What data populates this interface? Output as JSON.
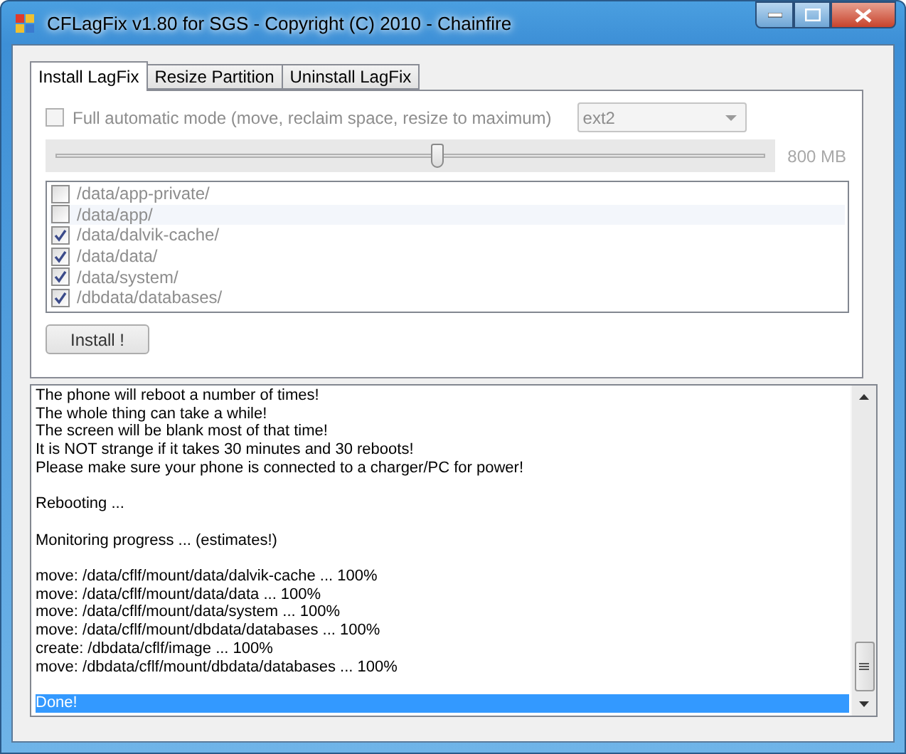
{
  "window": {
    "title": "CFLagFix v1.80 for SGS - Copyright (C) 2010 - Chainfire"
  },
  "tabs": [
    {
      "label": "Install LagFix",
      "selected": true
    },
    {
      "label": "Resize Partition",
      "selected": false
    },
    {
      "label": "Uninstall LagFix",
      "selected": false
    }
  ],
  "auto_mode": {
    "label": "Full automatic mode (move, reclaim space, resize to maximum)",
    "checked": false,
    "disabled": true
  },
  "filesystem_combo": {
    "value": "ext2",
    "disabled": true
  },
  "size_slider": {
    "level": 0.54,
    "reading": "800 MB",
    "disabled": true
  },
  "folders": {
    "disabled": true,
    "items": [
      {
        "label": "/data/app-private/",
        "checked": false,
        "selected": false
      },
      {
        "label": "/data/app/",
        "checked": false,
        "selected": true
      },
      {
        "label": "/data/dalvik-cache/",
        "checked": true,
        "selected": false
      },
      {
        "label": "/data/data/",
        "checked": true,
        "selected": false
      },
      {
        "label": "/data/system/",
        "checked": true,
        "selected": false
      },
      {
        "label": "/dbdata/databases/",
        "checked": true,
        "selected": false
      }
    ]
  },
  "install_button": {
    "label": "Install !"
  },
  "log": [
    {
      "text": "The phone will reboot a number of times!",
      "gap_before": false,
      "selected": false
    },
    {
      "text": "The whole thing can take a while!",
      "gap_before": false,
      "selected": false
    },
    {
      "text": "The screen will be blank most of that time!",
      "gap_before": false,
      "selected": false
    },
    {
      "text": "It is NOT strange if it takes 30 minutes and 30 reboots!",
      "gap_before": false,
      "selected": false
    },
    {
      "text": "Please make sure your phone is connected to a charger/PC for power!",
      "gap_before": false,
      "selected": false
    },
    {
      "text": "Rebooting ...",
      "gap_before": true,
      "selected": false
    },
    {
      "text": "Monitoring progress ... (estimates!)",
      "gap_before": true,
      "selected": false
    },
    {
      "text": "move: /data/cflf/mount/data/dalvik-cache ... 100%",
      "gap_before": true,
      "selected": false
    },
    {
      "text": "move: /data/cflf/mount/data/data ... 100%",
      "gap_before": false,
      "selected": false
    },
    {
      "text": "move: /data/cflf/mount/data/system ... 100%",
      "gap_before": false,
      "selected": false
    },
    {
      "text": "move: /data/cflf/mount/dbdata/databases ... 100%",
      "gap_before": false,
      "selected": false
    },
    {
      "text": "create: /dbdata/cflf/image ... 100%",
      "gap_before": false,
      "selected": false
    },
    {
      "text": "move: /dbdata/cflf/mount/dbdata/databases ... 100%",
      "gap_before": false,
      "selected": false
    },
    {
      "text": "Done!",
      "gap_before": true,
      "selected": true
    }
  ]
}
